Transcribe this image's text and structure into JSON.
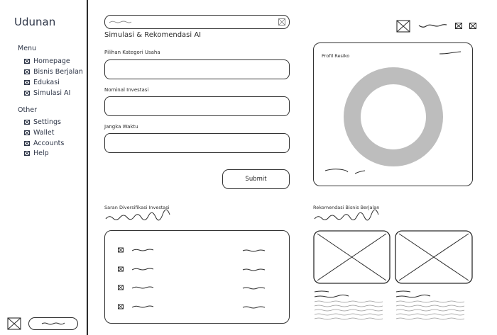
{
  "app": {
    "brand": "Udunan"
  },
  "sidebar": {
    "menu_label": "Menu",
    "menu_items": [
      {
        "label": "Homepage",
        "icon": "image-placeholder-icon"
      },
      {
        "label": "Bisnis Berjalan",
        "icon": "image-placeholder-icon"
      },
      {
        "label": "Edukasi",
        "icon": "image-placeholder-icon"
      },
      {
        "label": "Simulasi AI",
        "icon": "image-placeholder-icon"
      }
    ],
    "other_label": "Other",
    "other_items": [
      {
        "label": "Settings",
        "icon": "image-placeholder-icon"
      },
      {
        "label": "Wallet",
        "icon": "image-placeholder-icon"
      },
      {
        "label": "Accounts",
        "icon": "image-placeholder-icon"
      },
      {
        "label": "Help",
        "icon": "image-placeholder-icon"
      }
    ]
  },
  "page": {
    "title": "Simulasi & Rekomendasi AI"
  },
  "form": {
    "category_label": "Pilihan Kategori Usaha",
    "investment_label": "Nominal Investasi",
    "duration_label": "Jangka Waktu",
    "submit_label": "Submit"
  },
  "risk_profile": {
    "title": "Profil Resiko",
    "donut_color": "#bdbdbd"
  },
  "diversification": {
    "title": "Saran Diversifikasi Investasi"
  },
  "recommendation": {
    "title": "Rekomendasi Bisnis Berjalan"
  },
  "colors": {
    "ink": "#2b2b2b",
    "navy_text": "#2c3446"
  }
}
